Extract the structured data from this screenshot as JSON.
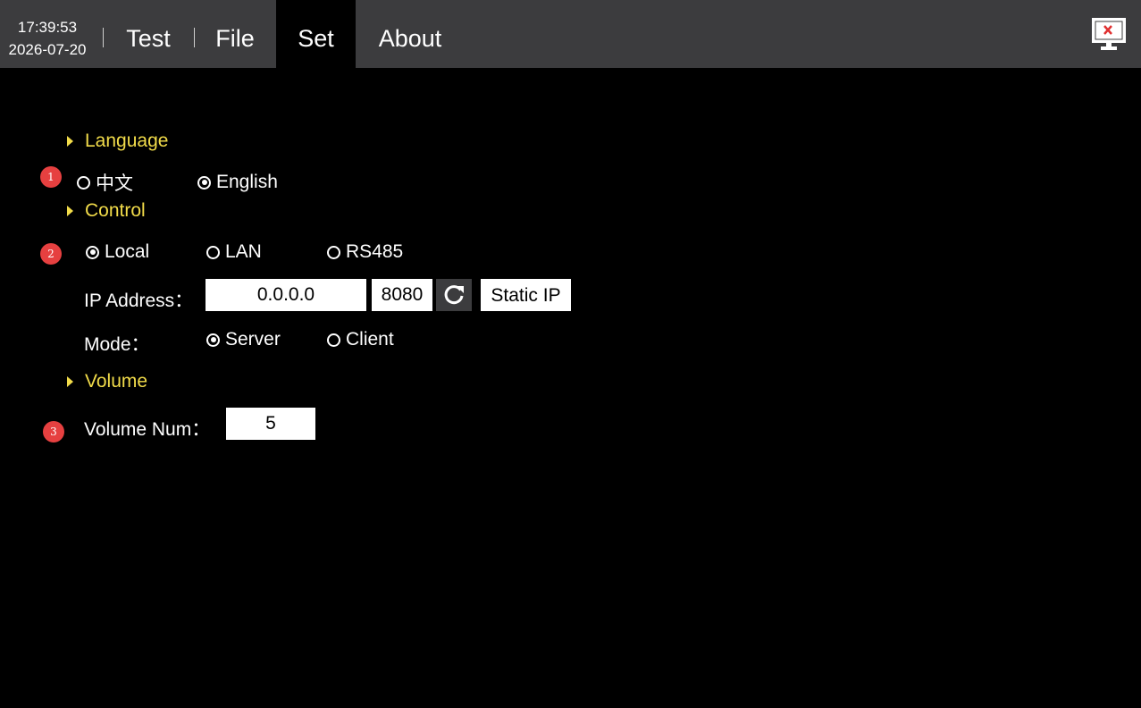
{
  "header": {
    "time": "17:39:53",
    "date": "2026-07-20",
    "tabs": [
      {
        "label": "Test"
      },
      {
        "label": "File"
      },
      {
        "label": "Set"
      },
      {
        "label": "About"
      }
    ],
    "active_tab": "Set",
    "close_icon": "monitor-close-icon"
  },
  "badges": [
    "1",
    "2",
    "3"
  ],
  "language": {
    "title": "Language",
    "options": [
      "中文",
      "English"
    ],
    "selected": "English"
  },
  "control": {
    "title": "Control",
    "options": [
      "Local",
      "LAN",
      "RS485"
    ],
    "selected": "Local",
    "ip_label": "IP Address：",
    "ip_value": "0.0.0.0",
    "port_value": "8080",
    "refresh_icon": "refresh-icon",
    "static_ip_label": "Static IP",
    "mode_label": "Mode：",
    "mode_options": [
      "Server",
      "Client"
    ],
    "mode_selected": "Server"
  },
  "volume": {
    "title": "Volume",
    "num_label": "Volume Num：",
    "num_value": "5"
  },
  "colors": {
    "accent": "#f2dc4a",
    "badge": "#e64040",
    "topbar": "#3c3c3e",
    "background": "#000000"
  }
}
